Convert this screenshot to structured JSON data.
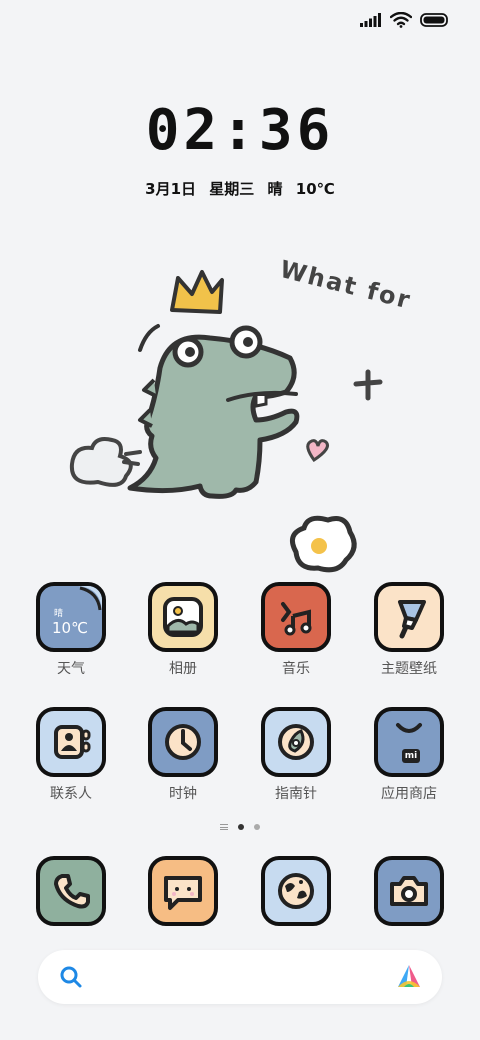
{
  "time": "02:36",
  "date": {
    "day": "3月1日",
    "weekday": "星期三",
    "weather": "晴",
    "temperature": "10℃"
  },
  "wallpaper": {
    "text": "What for"
  },
  "apps_row1": [
    {
      "label": "天气",
      "icon": "weather-icon",
      "bg": "#7f9cc4",
      "widget_text": "晴",
      "widget_temp": "10℃"
    },
    {
      "label": "相册",
      "icon": "photo-icon",
      "bg": "#f6dfaa"
    },
    {
      "label": "音乐",
      "icon": "music-note-icon",
      "bg": "#d9674e"
    },
    {
      "label": "主题壁纸",
      "icon": "paint-brush-icon",
      "bg": "#fbe3c8"
    }
  ],
  "apps_row2": [
    {
      "label": "联系人",
      "icon": "contacts-icon",
      "bg": "#c7dbf0"
    },
    {
      "label": "时钟",
      "icon": "clock-icon",
      "bg": "#7f9cc4"
    },
    {
      "label": "指南针",
      "icon": "compass-icon",
      "bg": "#c7dbf0"
    },
    {
      "label": "应用商店",
      "icon": "store-bag-icon",
      "bg": "#7f9cc4",
      "badge": "mi"
    }
  ],
  "dock": [
    {
      "icon": "phone-icon",
      "bg": "#8fb09e"
    },
    {
      "icon": "message-icon",
      "bg": "#f6bd84"
    },
    {
      "icon": "browser-globe-icon",
      "bg": "#c7dbf0"
    },
    {
      "icon": "camera-icon",
      "bg": "#7f9cc4"
    }
  ]
}
